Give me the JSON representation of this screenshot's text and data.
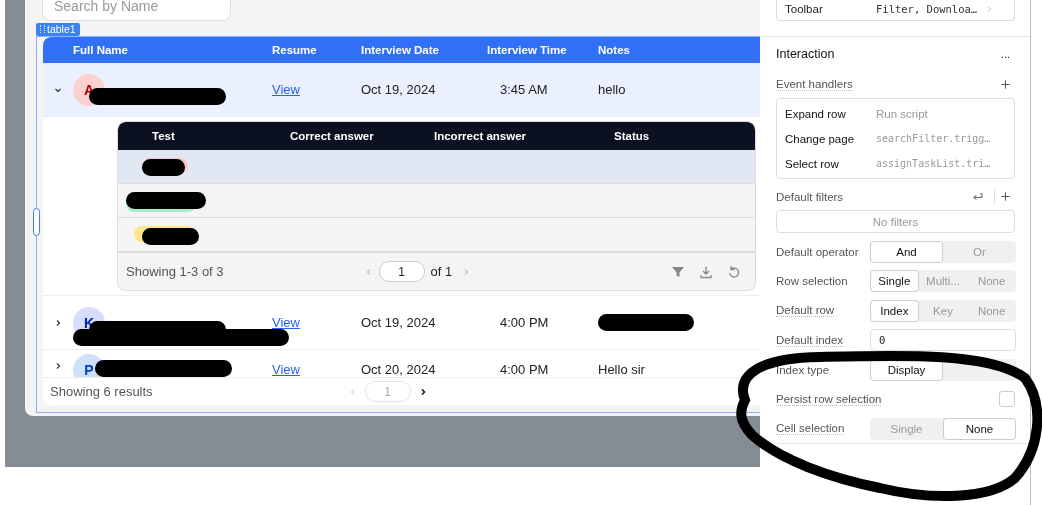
{
  "search": {
    "placeholder": "Search by Name"
  },
  "table_label": "table1",
  "table": {
    "columns": [
      "Full Name",
      "Resume",
      "Interview Date",
      "Interview Time",
      "Notes"
    ],
    "rows": [
      {
        "expanded": true,
        "selected": true,
        "avatar": "A",
        "color": "#fdd0d0",
        "resume": "View",
        "date": "Oct 19, 2024",
        "time": "3:45 AM",
        "notes": "hello"
      },
      {
        "expanded": false,
        "selected": false,
        "avatar": "K",
        "color": "#d6dcfb",
        "resume": "View",
        "date": "Oct 19, 2024",
        "time": "4:00 PM"
      },
      {
        "expanded": false,
        "selected": false,
        "avatar": "P",
        "color": "#cfe0fb",
        "resume": "View",
        "date": "Oct 20, 2024",
        "time": "4:00 PM",
        "notes": "Hello sir"
      }
    ],
    "footer": "Showing 6 results",
    "page": "1"
  },
  "nested_table": {
    "columns": [
      "Test",
      "Correct answer",
      "Incorrect answer",
      "Status"
    ],
    "rows": [
      {
        "color": "#f9c7c7",
        "selected": true
      },
      {
        "color": "#a7efc9",
        "selected": false
      },
      {
        "color": "#fde68a",
        "selected": false
      }
    ],
    "footer": "Showing 1-3 of 3",
    "page": "1",
    "page_total": "of 1"
  },
  "inspector": {
    "toolbar": {
      "label": "Toolbar",
      "value": "Filter, Downloa…"
    },
    "section": "Interaction",
    "section_menu": "...",
    "event_handlers": {
      "label": "Event handlers",
      "items": [
        {
          "event": "Expand row",
          "action": "Run script",
          "kind": "plain"
        },
        {
          "event": "Change page",
          "action": "searchFilter.trigg…",
          "kind": "code"
        },
        {
          "event": "Select row",
          "action": "assignTaskList.tri…",
          "kind": "code"
        }
      ]
    },
    "default_filters": {
      "label": "Default filters",
      "empty": "No filters"
    },
    "settings": [
      {
        "kind": "segmented",
        "label": "Default operator",
        "tooltip": false,
        "options": [
          {
            "label": "And",
            "selected": true
          },
          {
            "label": "Or",
            "selected": false
          }
        ]
      },
      {
        "kind": "segmented",
        "label": "Row selection",
        "tooltip": false,
        "options": [
          {
            "label": "Single",
            "selected": true
          },
          {
            "label": "Multi...",
            "selected": false
          },
          {
            "label": "None",
            "selected": false
          }
        ]
      },
      {
        "kind": "segmented",
        "label": "Default row",
        "tooltip": true,
        "options": [
          {
            "label": "Index",
            "selected": true
          },
          {
            "label": "Key",
            "selected": false
          },
          {
            "label": "None",
            "selected": false
          }
        ]
      },
      {
        "kind": "input",
        "label": "Default index",
        "tooltip": true,
        "value": "0"
      },
      {
        "kind": "segmented",
        "label": "Index type",
        "tooltip": false,
        "options": [
          {
            "label": "Display",
            "selected": true
          }
        ]
      },
      {
        "kind": "checkbox",
        "label": "Persist row selection",
        "tooltip": true,
        "checked": false
      },
      {
        "kind": "segmented",
        "label": "Cell selection",
        "tooltip": true,
        "options": [
          {
            "label": "Single",
            "selected": false
          },
          {
            "label": "None",
            "selected": true
          }
        ]
      }
    ]
  }
}
